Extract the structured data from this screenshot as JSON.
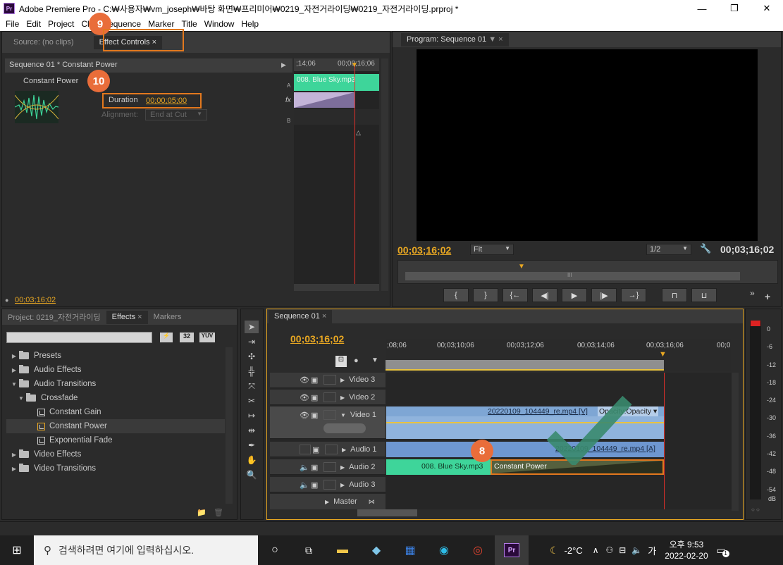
{
  "window": {
    "title": "Adobe Premiere Pro - C:₩사용자₩vm_joseph₩바탕 화면₩프리미어₩0219_자전거라이딩₩0219_자전거라이딩.prproj *",
    "app_icon": "Pr",
    "minimize": "—",
    "maximize": "❐",
    "close": "✕"
  },
  "menu": [
    "File",
    "Edit",
    "Project",
    "Clip",
    "Sequence",
    "Marker",
    "Title",
    "Window",
    "Help"
  ],
  "source_panel": {
    "tab_source": "Source: (no clips)",
    "tab_effect_controls": "Effect Controls",
    "close": "×",
    "header": "Sequence 01 * Constant Power",
    "transition_name": "Constant Power",
    "duration_label": "Duration",
    "duration_value": "00;00;05;00",
    "alignment_label": "Alignment:",
    "alignment_value": "End at Cut",
    "ruler_left": ";14;06",
    "ruler_right": "00;00;16;06",
    "track_a": "A",
    "track_b": "B",
    "fx": "fx",
    "clip_a_label": "008. Blue Sky.mp3",
    "timecode": "00;03;16;02"
  },
  "program_panel": {
    "tab": "Program: Sequence 01",
    "timecode_left": "00;03;16;02",
    "timecode_right": "00;03;16;02",
    "fit": "Fit",
    "resolution": "1/2",
    "ruler_label": "III"
  },
  "project_panel": {
    "tab_project": "Project: 0219_자전거라이딩",
    "tab_effects": "Effects",
    "tab_markers": "Markers",
    "preset_btn": "32",
    "yuv_btn": "YUV",
    "tree": [
      {
        "label": "Presets",
        "level": 0,
        "arrow": "▶",
        "type": "folder-star"
      },
      {
        "label": "Audio Effects",
        "level": 0,
        "arrow": "▶",
        "type": "folder"
      },
      {
        "label": "Audio Transitions",
        "level": 0,
        "arrow": "▼",
        "type": "folder"
      },
      {
        "label": "Crossfade",
        "level": 1,
        "arrow": "▼",
        "type": "folder"
      },
      {
        "label": "Constant Gain",
        "level": 2,
        "arrow": "",
        "type": "fx"
      },
      {
        "label": "Constant Power",
        "level": 2,
        "arrow": "",
        "type": "fx",
        "selected": true
      },
      {
        "label": "Exponential Fade",
        "level": 2,
        "arrow": "",
        "type": "fx"
      },
      {
        "label": "Video Effects",
        "level": 0,
        "arrow": "▶",
        "type": "folder"
      },
      {
        "label": "Video Transitions",
        "level": 0,
        "arrow": "▶",
        "type": "folder"
      }
    ]
  },
  "timeline": {
    "tab": "Sequence 01",
    "timecode": "00;03;16;02",
    "ruler": [
      ";08;06",
      "00;03;10;06",
      "00;03;12;06",
      "00;03;14;06",
      "00;03;16;06",
      "00;0"
    ],
    "tracks": [
      {
        "name": "Video 3"
      },
      {
        "name": "Video 2"
      },
      {
        "name": "Video 1"
      },
      {
        "name": "Audio 1"
      },
      {
        "name": "Audio 2"
      },
      {
        "name": "Audio 3"
      },
      {
        "name": "Master"
      }
    ],
    "video_clip": "20220109_104449_re.mp4 [V]",
    "opacity": "Opacity:Opacity ▾",
    "audio_clip": "20220109_104449_re.mp4 [A]",
    "audio2_clip": "008. Blue Sky.mp3",
    "transition": "Constant Power"
  },
  "meter": {
    "labels": [
      "0",
      "-6",
      "-12",
      "-18",
      "-24",
      "-30",
      "-36",
      "-42",
      "-48",
      "-54",
      "dB"
    ]
  },
  "badges": {
    "b8": "8",
    "b9": "9",
    "b10": "10"
  },
  "colors": {
    "accent": "#e8a722",
    "highlight": "#e2781e",
    "badge": "#e96d3a",
    "green_clip": "#3ed59a",
    "blue_clip": "#8fb3dc",
    "check": "#3a8a6e"
  },
  "taskbar": {
    "search_placeholder": "검색하려면 여기에 입력하십시오.",
    "weather": "-2°C",
    "time": "오후 9:53",
    "date": "2022-02-20",
    "ime": "가",
    "notification_count": "1"
  }
}
